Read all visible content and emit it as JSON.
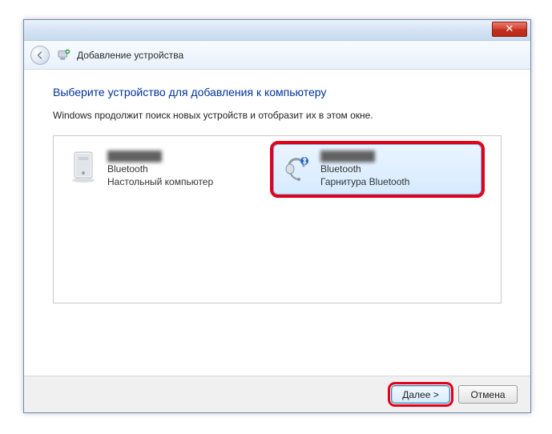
{
  "window": {
    "close_symbol": "✕"
  },
  "header": {
    "title": "Добавление устройства"
  },
  "main": {
    "title": "Выберите устройство для добавления к компьютеру",
    "subtitle": "Windows продолжит поиск новых устройств и отобразит их в этом окне."
  },
  "devices": [
    {
      "name": "████████",
      "type": "Bluetooth",
      "desc": "Настольный компьютер",
      "icon": "desktop",
      "selected": false
    },
    {
      "name": "████████",
      "type": "Bluetooth",
      "desc": "Гарнитура Bluetooth",
      "icon": "headset",
      "selected": true
    }
  ],
  "footer": {
    "next_label": "Далее >",
    "cancel_label": "Отмена"
  }
}
